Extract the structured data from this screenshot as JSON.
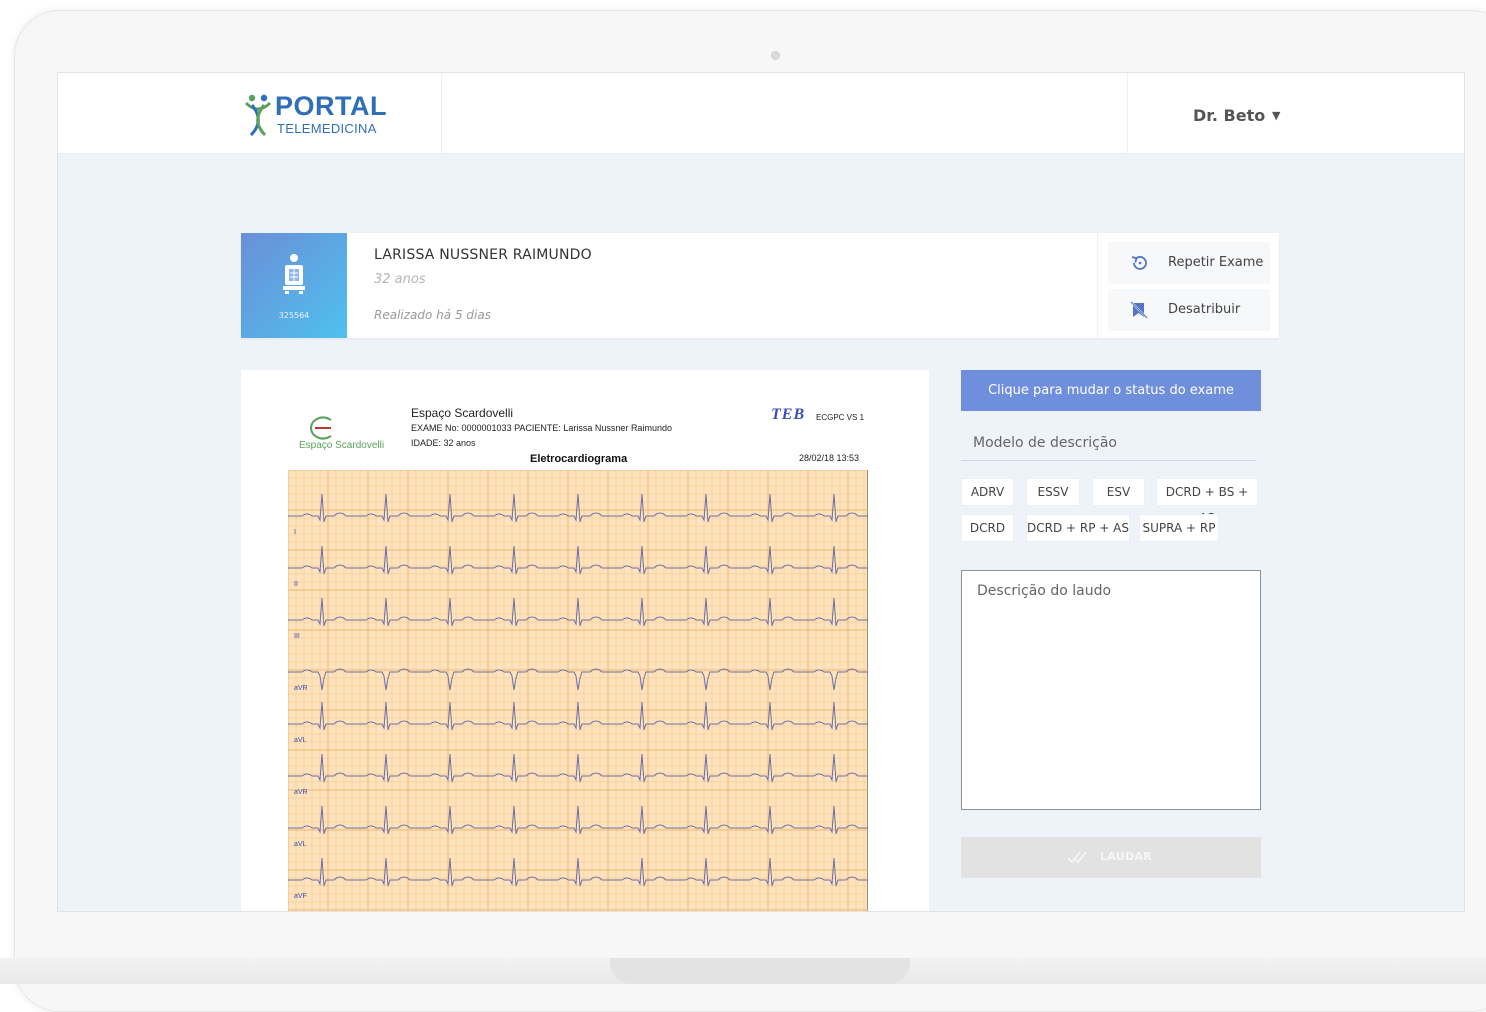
{
  "header": {
    "logo_title": "PORTAL",
    "logo_subtitle": "TELEMEDICINA",
    "user_name": "Dr. Beto"
  },
  "patient": {
    "name": "LARISSA NUSSNER RAIMUNDO",
    "age": "32 anos",
    "performed": "Realizado há 5 dias",
    "badge_id": "325564"
  },
  "actions": {
    "repeat_label": "Repetir Exame",
    "unassign_label": "Desatribuir"
  },
  "ecg": {
    "clinic": "Espaço Scardovelli",
    "logo_text": "Espaço Scardovelli",
    "line1": "EXAME No: 0000001033  PACIENTE: Larissa Nussner Raimundo",
    "line2": "IDADE: 32 anos",
    "title": "Eletrocardiograma",
    "brand": "TEB",
    "brand_sub": "ECGPC VS 1",
    "datetime": "28/02/18 13:53",
    "leads": [
      "I",
      "II",
      "III",
      "aVR",
      "aVL",
      "aVR",
      "aVL",
      "aVF"
    ],
    "colors": {
      "grid_bg": "#fde3bd",
      "grid_line": "#f3b46a",
      "trace": "#6a6fa8"
    }
  },
  "right_panel": {
    "status_button": "Clique para mudar o status do exame",
    "model_label": "Modelo de descrição",
    "chips": [
      "ADRV",
      "ESSV",
      "ESV",
      "DCRD + BS + AS",
      "DCRD",
      "DCRD + RP + AS",
      "SUPRA + RP"
    ],
    "description_placeholder": "Descrição do laudo",
    "laudar_label": "LAUDAR"
  },
  "colors": {
    "brand_blue": "#2e6fb7",
    "accent": "#6f8fdc",
    "page_bg": "#eef3f9"
  }
}
